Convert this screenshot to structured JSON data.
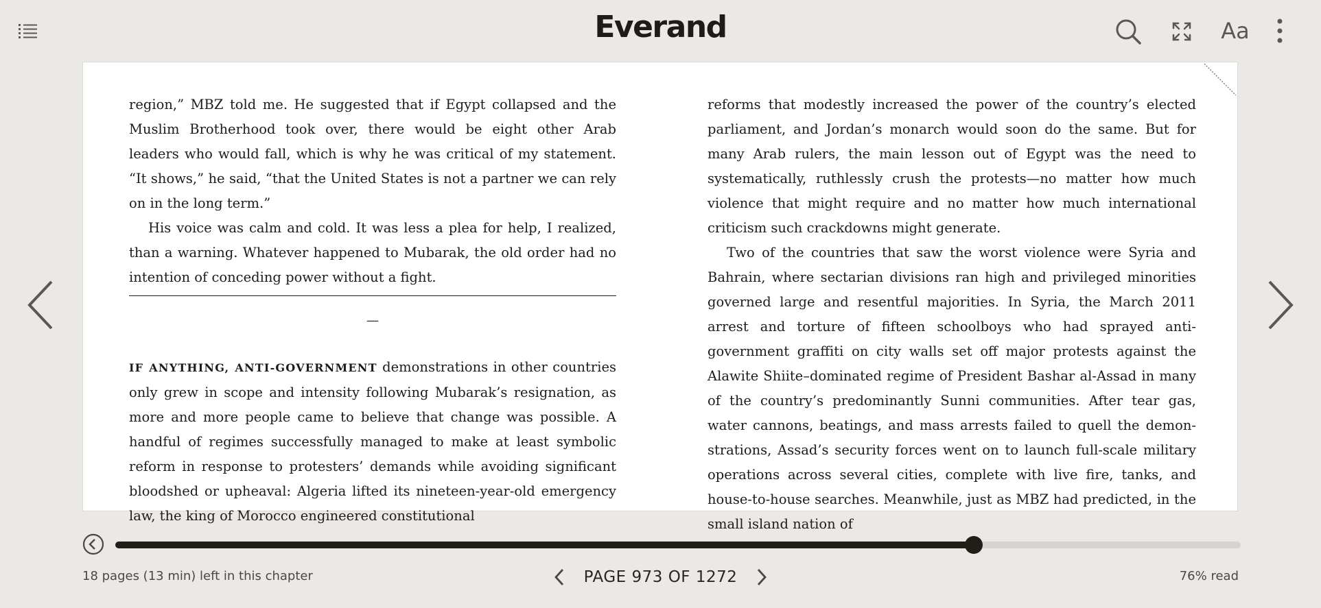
{
  "app": {
    "logo": "Everand"
  },
  "toolbar": {
    "toc_icon": "list-icon",
    "search_icon": "search-icon",
    "fullscreen_icon": "fullscreen-icon",
    "font_label": "Aa",
    "more_icon": "more-vertical-icon"
  },
  "book": {
    "left": {
      "p1": "region,” MBZ told me. He suggested that if Egypt collapsed and the Muslim Brotherhood took over, there would be eight other Arab leaders who would fall, which is why he was critical of my statement. “It shows,” he said, “that the United States is not a partner we can rely on in the long term.”",
      "p2": "His voice was calm and cold. It was less a plea for help, I realized, than a warning. Whatever happened to Mubarak, the old order had no intention of conceding power without a fight.",
      "separator": "—",
      "p3_lead": "If anything, anti-government",
      "p3": " demonstrations in other countries only grew in scope and intensity following Mubarak’s resignation, as more and more peo­ple came to believe that change was possible. A handful of regimes success­fully managed to make at least symbolic reform in response to protesters’ de­mands while avoiding significant bloodshed or upheaval: Algeria lifted its nine­teen-year-old emergency law, the king of Morocco engineered constitutional"
    },
    "right": {
      "p1": "reforms that modestly increased the power of the country’s elected parliament, and Jordan’s monarch would soon do the same. But for many Arab rulers, the main lesson out of Egypt was the need to systematically, ruthlessly crush the protests—no matter how much violence that might require and no matter how much international criticism such crackdowns might generate.",
      "p2": "Two of the countries that saw the worst violence were Syria and Bahrain, where sectarian divisions ran high and privileged minorities governed large and resentful majorities. In Syria, the March 2011 arrest and torture of fifteen schoolboys who had sprayed anti-government graffiti on city walls set off major protests against the Alawite Shiite–dominated regime of President Bashar al-Assad in many of the country’s predominantly Sunni communities. After tear gas, water cannons, beatings, and mass arrests failed to quell the demon­strations, Assad’s security forces went on to launch full-scale military opera­tions across several cities, complete with live fire, tanks, and house-to-house searches. Meanwhile, just as MBZ had predicted, in the small island nation of"
    }
  },
  "navigation": {
    "prev_icon": "chevron-left-icon",
    "next_icon": "chevron-right-icon"
  },
  "progress": {
    "fraction": 0.763,
    "back_icon": "back-arrow-circle-icon",
    "chapter_left": "18 pages (13 min) left in this chapter",
    "page_label": "PAGE 973 OF 1272",
    "percent_read": "76% read"
  },
  "colors": {
    "background": "#ebe9e6",
    "ink": "#1e1b18",
    "track": "#d6d4d0"
  }
}
